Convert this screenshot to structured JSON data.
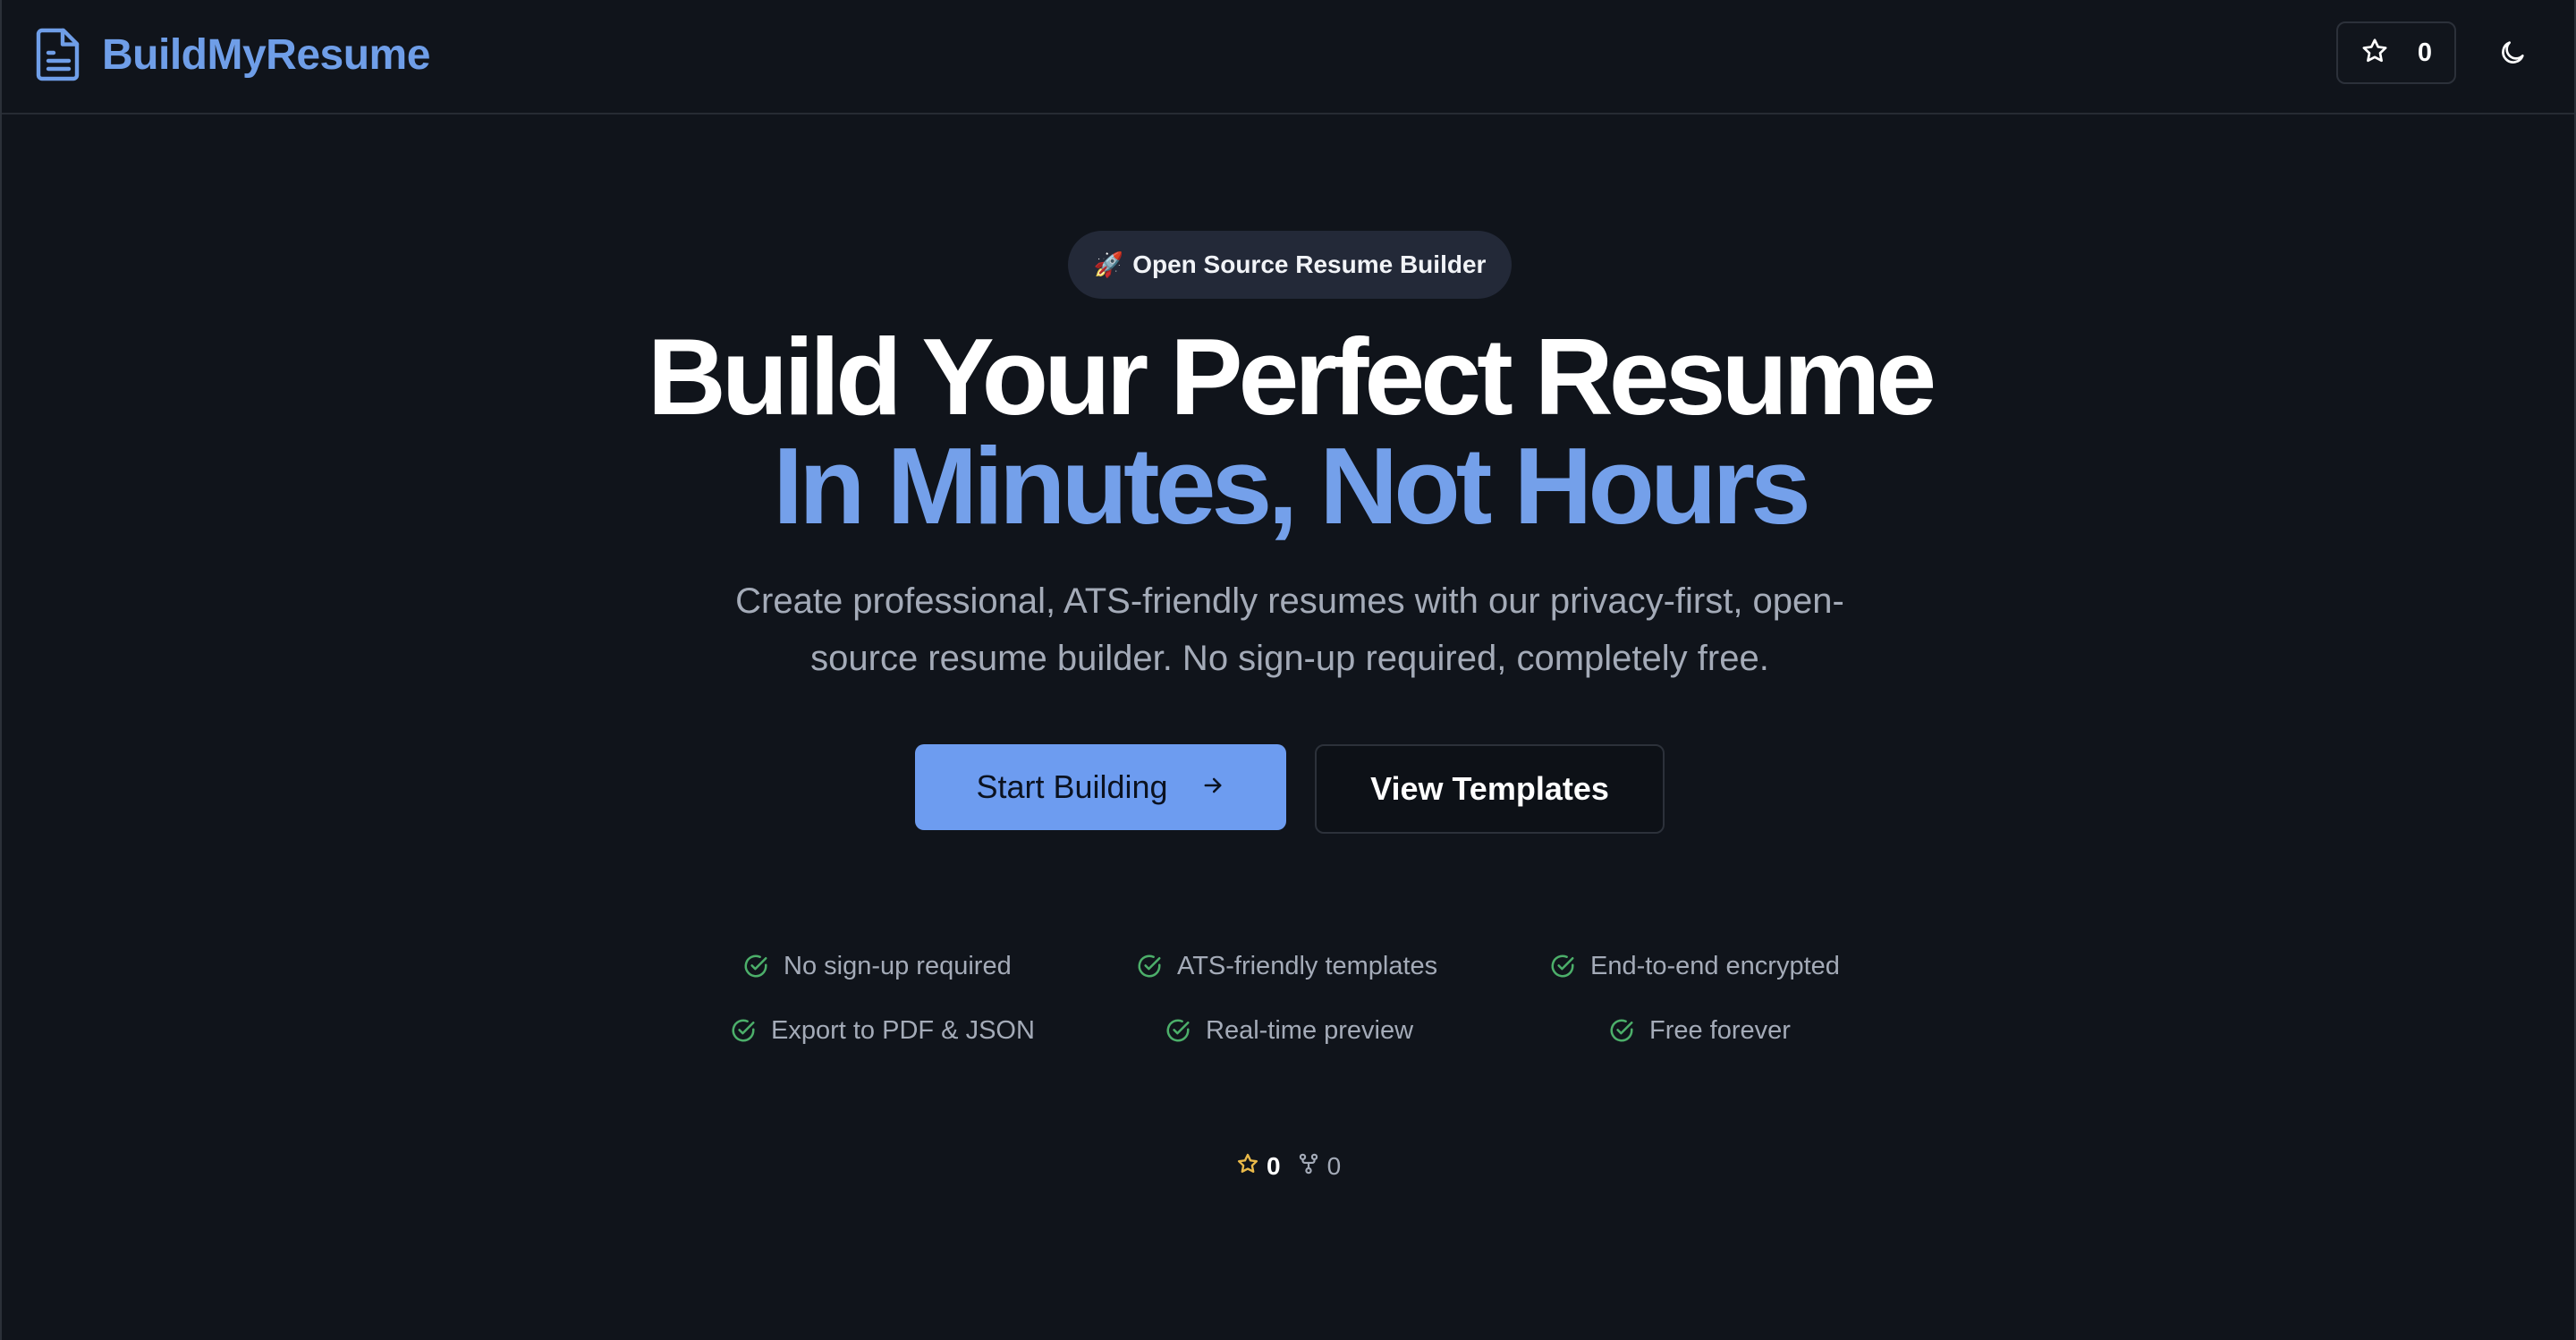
{
  "header": {
    "brand": "BuildMyResume",
    "star_count": "0"
  },
  "hero": {
    "badge_emoji": "🚀",
    "badge": "Open Source Resume Builder",
    "title_line1": "Build Your Perfect Resume",
    "title_line2": "In Minutes, Not Hours",
    "subtitle": "Create professional, ATS-friendly resumes with our privacy-first, open-source resume builder. No sign-up required, completely free.",
    "primary_button": "Start Building",
    "secondary_button": "View Templates"
  },
  "features": [
    "No sign-up required",
    "ATS-friendly templates",
    "End-to-end encrypted",
    "Export to PDF & JSON",
    "Real-time preview",
    "Free forever"
  ],
  "stats": {
    "stars": "0",
    "forks": "0"
  },
  "colors": {
    "background": "#10141b",
    "accent": "#6f9ee8",
    "check": "#4caf6a",
    "star": "#e9b949"
  },
  "icons": {
    "brand": "document-icon",
    "header_star": "star-icon",
    "theme": "moon-icon",
    "primary_button": "arrow-right-icon",
    "feature": "check-circle-icon",
    "stats_star": "star-icon",
    "stats_fork": "fork-icon"
  }
}
